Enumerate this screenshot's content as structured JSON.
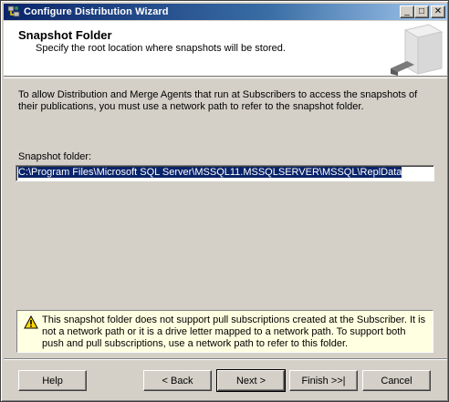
{
  "window": {
    "title": "Configure Distribution Wizard",
    "controls": {
      "minimize": "_",
      "maximize": "□",
      "close": "✕"
    }
  },
  "header": {
    "title": "Snapshot Folder",
    "subtitle": "Specify the root location where snapshots will be stored."
  },
  "main": {
    "intro": "To allow Distribution and Merge Agents that run at Subscribers to access the snapshots of their publications, you must use a network path to refer to the snapshot folder.",
    "folder_label": "Snapshot folder:",
    "folder_value": "C:\\Program Files\\Microsoft SQL Server\\MSSQL11.MSSQLSERVER\\MSSQL\\ReplData"
  },
  "warning": {
    "icon": "warning-icon",
    "text": "This snapshot folder does not support pull subscriptions created at the Subscriber. It is not a network path or it is a drive letter mapped to a network path. To support both push and pull subscriptions, use a network path to refer to this folder."
  },
  "buttons": {
    "help": "Help",
    "back": "< Back",
    "next": "Next >",
    "finish": "Finish >>|",
    "cancel": "Cancel"
  },
  "colors": {
    "titlebar_start": "#0a246a",
    "titlebar_end": "#a6caf0",
    "dialog_bg": "#d4d0c8",
    "warning_bg": "#ffffe1",
    "selection": "#0a246a"
  }
}
